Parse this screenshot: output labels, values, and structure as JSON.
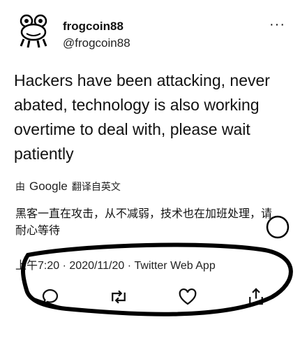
{
  "author": {
    "display_name": "frogcoin88",
    "handle": "@frogcoin88",
    "avatar_icon": "frog-avatar-icon"
  },
  "menu": {
    "more_label": "···"
  },
  "tweet": {
    "text": "Hackers have been attacking, never abated, technology is also working overtime to deal with, please wait patiently"
  },
  "translation": {
    "prefix": "由",
    "provider": "Google",
    "suffix": "翻译自英文",
    "text": "黑客一直在攻击，从不减弱，技术也在加班处理，请耐心等待"
  },
  "meta": {
    "time": "上午7:20",
    "sep1": "·",
    "date": "2020/11/20",
    "sep2": "·",
    "source": "Twitter Web App"
  },
  "actions": [
    "reply-icon",
    "retweet-icon",
    "like-icon",
    "share-icon"
  ],
  "colors": {
    "text": "#111111",
    "background": "#ffffff",
    "annotation": "#000000"
  }
}
